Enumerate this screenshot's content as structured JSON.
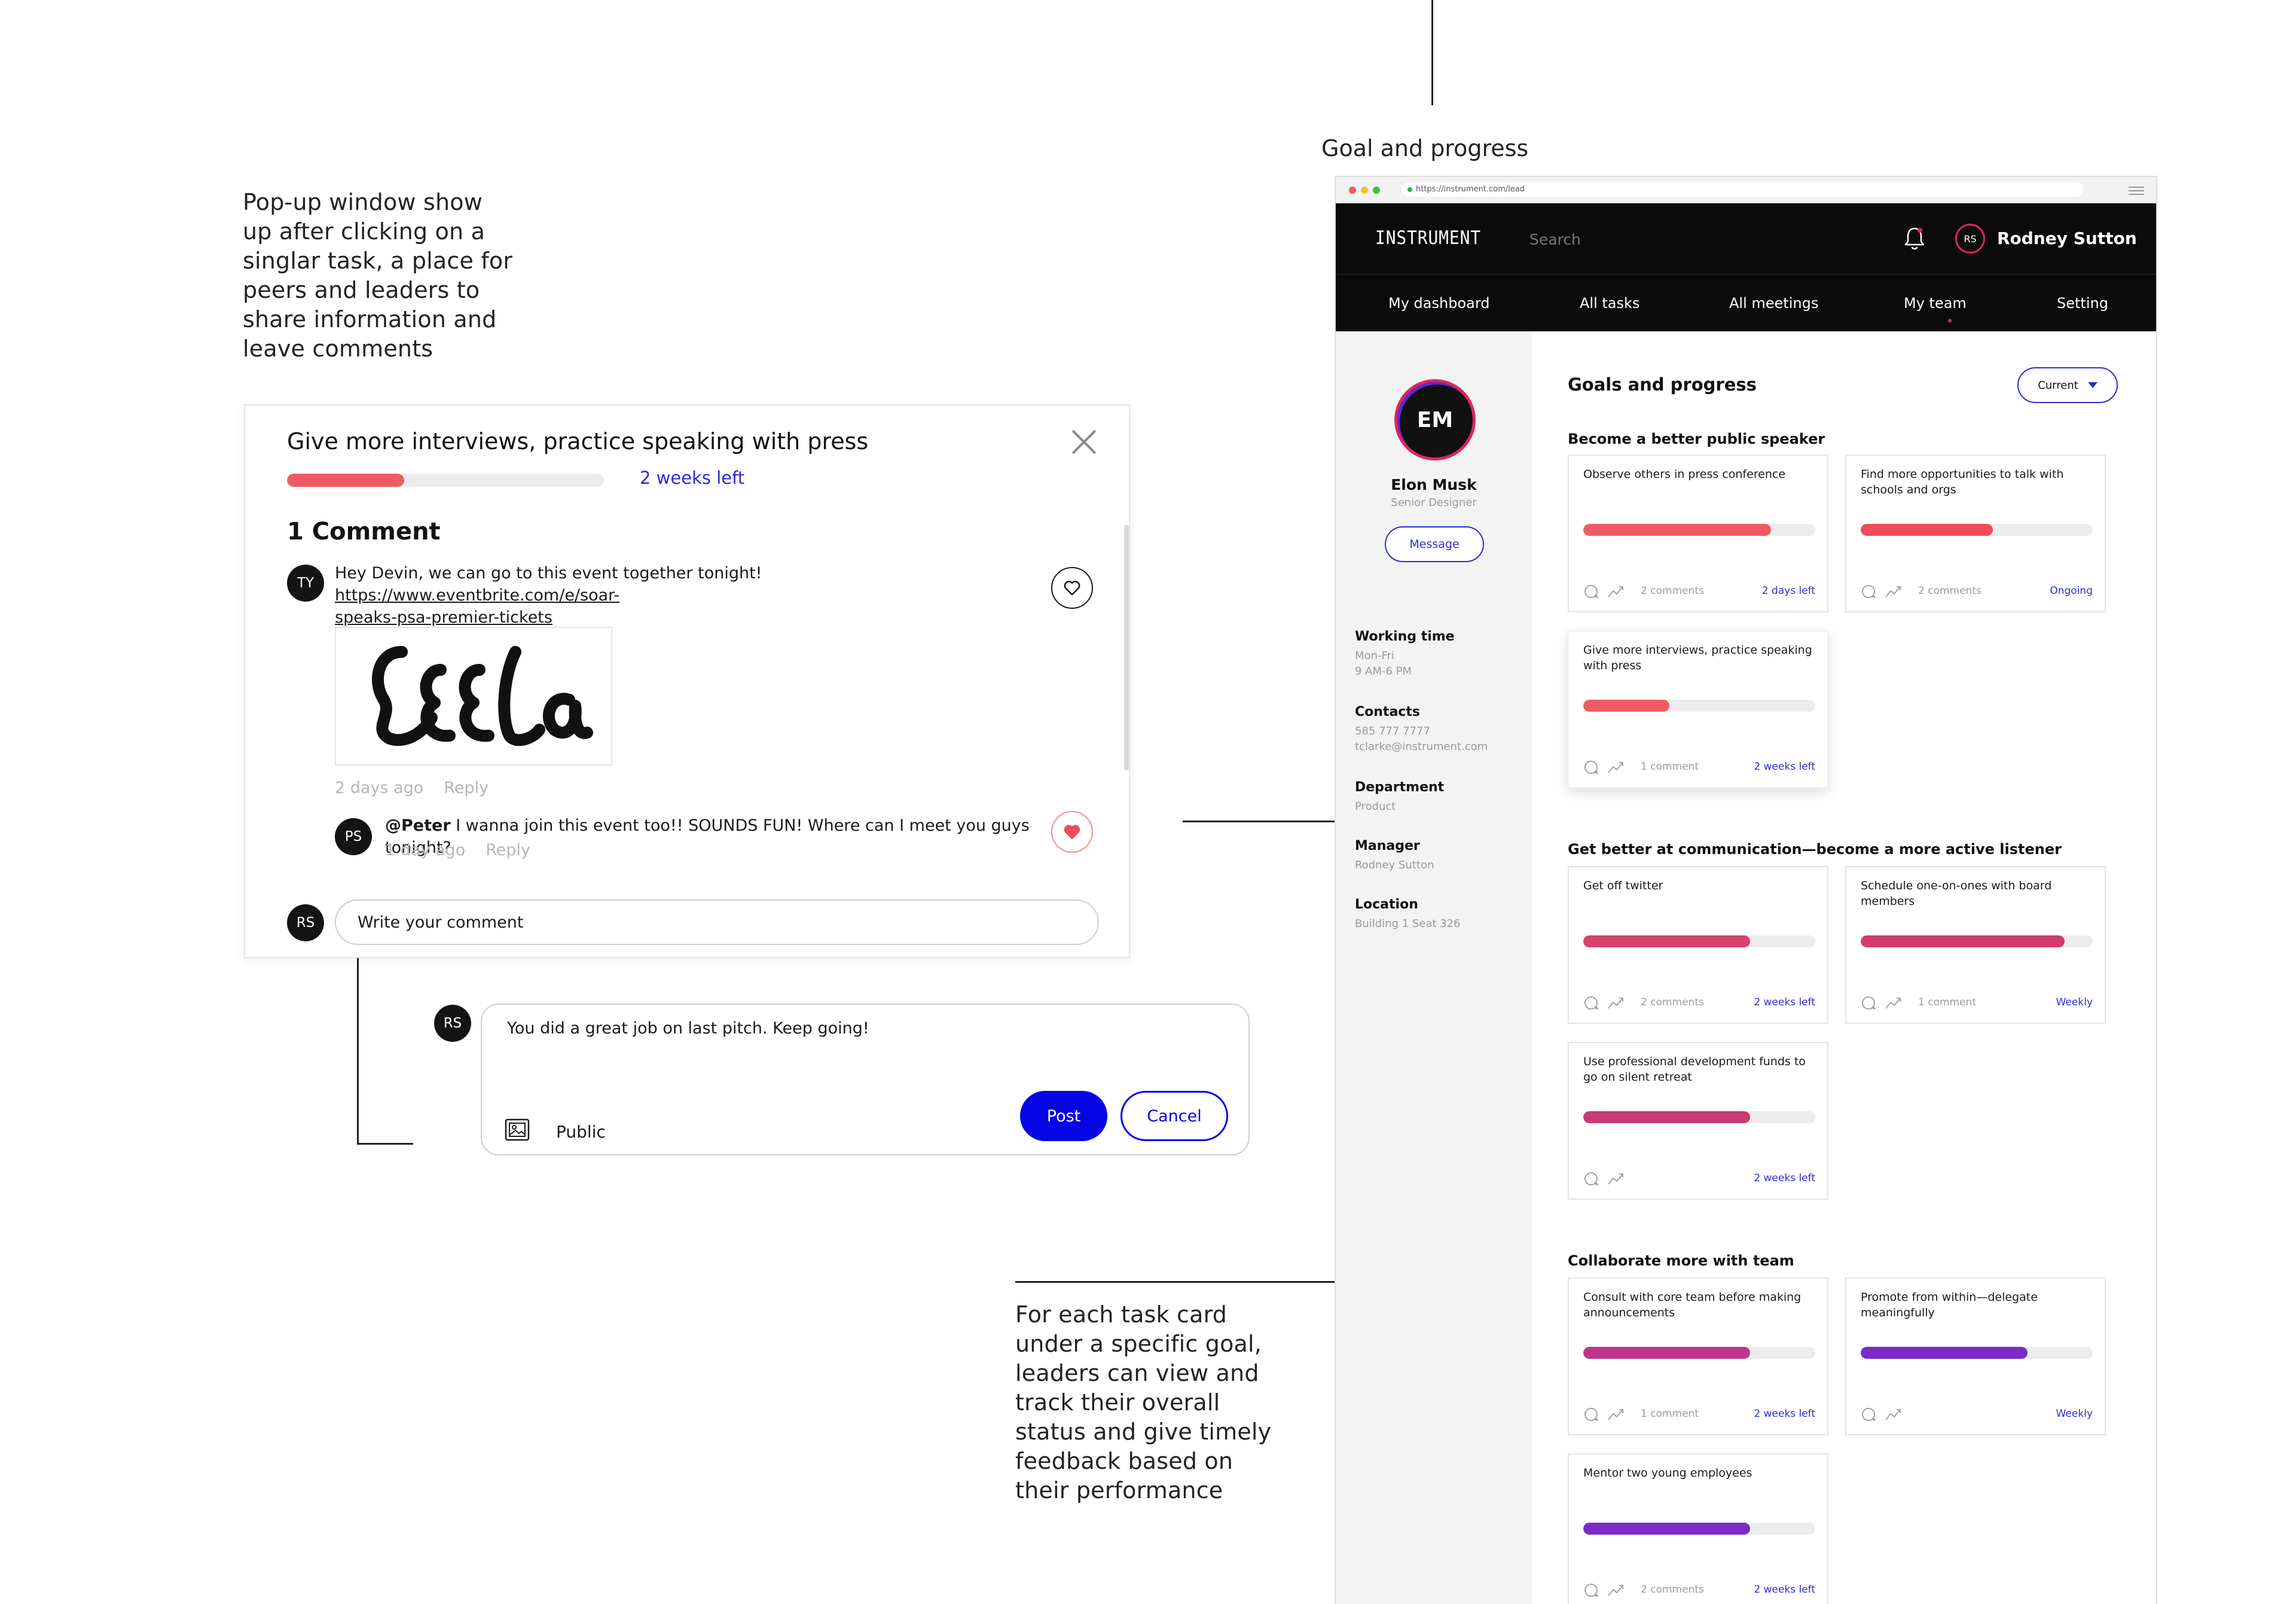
{
  "annotations": {
    "popup_note": [
      "Pop-up window show",
      "up after clicking on a",
      "singlar task, a place for",
      "peers and leaders to",
      "share information and",
      "leave comments"
    ],
    "card_note": [
      "For each task card",
      "under a specific goal,",
      "leaders can view and",
      "track their overall",
      "status and give timely",
      "feedback based on",
      "their performance"
    ],
    "section_title": "Goal and progress"
  },
  "popup": {
    "title": "Give more interviews, practice speaking with press",
    "progress": 0.37,
    "progress_color": "#ef5b64",
    "time_left": "2 weeks left",
    "comment_count": "1 Comment",
    "comments": [
      {
        "initials": "TY",
        "text_before": "Hey Devin, we can go to this event together tonight! ",
        "link_line1": "https://www.eventbrite.com/e/soar-",
        "link_line2": "speaks-psa-premier-tickets",
        "image_text": "LEELA",
        "meta_time": "2 days ago",
        "meta_reply": "Reply",
        "liked": false
      },
      {
        "initials": "PS",
        "mention": "@Peter",
        "text": " I wanna join this event too!! SOUNDS FUN! Where can I meet you guys tonight?",
        "meta_time": "1 day ago",
        "meta_reply": "Reply",
        "liked": true
      }
    ],
    "composer_initials": "RS",
    "write_placeholder": "Write your comment"
  },
  "composer": {
    "initials": "RS",
    "text": "You did a great job on last pitch. Keep going!",
    "visibility": "Public",
    "post_label": "Post",
    "cancel_label": "Cancel"
  },
  "browser": {
    "url": "https://instrument.com/lead",
    "brand": "INSTRUMENT",
    "search_placeholder": "Search",
    "user_initials": "RS",
    "user_name": "Rodney Sutton",
    "nav": [
      "My dashboard",
      "All tasks",
      "All meetings",
      "My team",
      "Setting"
    ],
    "active_nav": "My team",
    "profile": {
      "initials": "EM",
      "name": "Elon Musk",
      "role": "Senior Designer",
      "message_label": "Message",
      "working_time_label": "Working time",
      "working_time": [
        "Mon-Fri",
        "9 AM-6 PM"
      ],
      "contacts_label": "Contacts",
      "contacts": [
        "585 777 7777",
        "tclarke@instrument.com"
      ],
      "department_label": "Department",
      "department": "Product",
      "manager_label": "Manager",
      "manager": "Rodney Sutton",
      "location_label": "Location",
      "location": "Building 1 Seat 326"
    },
    "main_title": "Goals and progress",
    "filter_label": "Current",
    "goals": [
      {
        "title": "Become a better public speaker",
        "cards": [
          {
            "text": "Observe others in press conference",
            "progress": 0.81,
            "color": "#ef5b64",
            "count": "2 comments",
            "status": "2 days left"
          },
          {
            "text": "Find more opportunities to talk with schools and orgs",
            "progress": 0.57,
            "color": "#ef4b5a",
            "count": "2 comments",
            "status": "Ongoing"
          },
          {
            "text": "Give more interviews, practice speaking with press",
            "progress": 0.37,
            "color": "#ef5b64",
            "count": "1 comment",
            "status": "2 weeks left",
            "raised": true
          }
        ]
      },
      {
        "title": "Get better at communication—become a more active listener",
        "cards": [
          {
            "text": "Get off twitter",
            "progress": 0.72,
            "color": "#d9416e",
            "count": "2 comments",
            "status": "2 weeks left"
          },
          {
            "text": "Schedule one-on-ones with board members",
            "progress": 0.88,
            "color": "#d23a70",
            "count": "1 comment",
            "status": "Weekly"
          },
          {
            "text": "Use professional development funds to go on silent retreat",
            "progress": 0.72,
            "color": "#cc3a72",
            "count": "",
            "status": "2 weeks left"
          }
        ]
      },
      {
        "title": "Collaborate more with team",
        "cards": [
          {
            "text": "Consult with core team before making announcements",
            "progress": 0.72,
            "color": "#c0358a",
            "count": "1 comment",
            "status": "2 weeks left"
          },
          {
            "text": "Promote from within—delegate meaningfully",
            "progress": 0.72,
            "color": "#7a2bc8",
            "count": "",
            "status": "Weekly"
          },
          {
            "text": "Mentor two young employees",
            "progress": 0.72,
            "color": "#7a2bc8",
            "count": "2 comments",
            "status": "2 weeks left"
          }
        ]
      }
    ]
  }
}
